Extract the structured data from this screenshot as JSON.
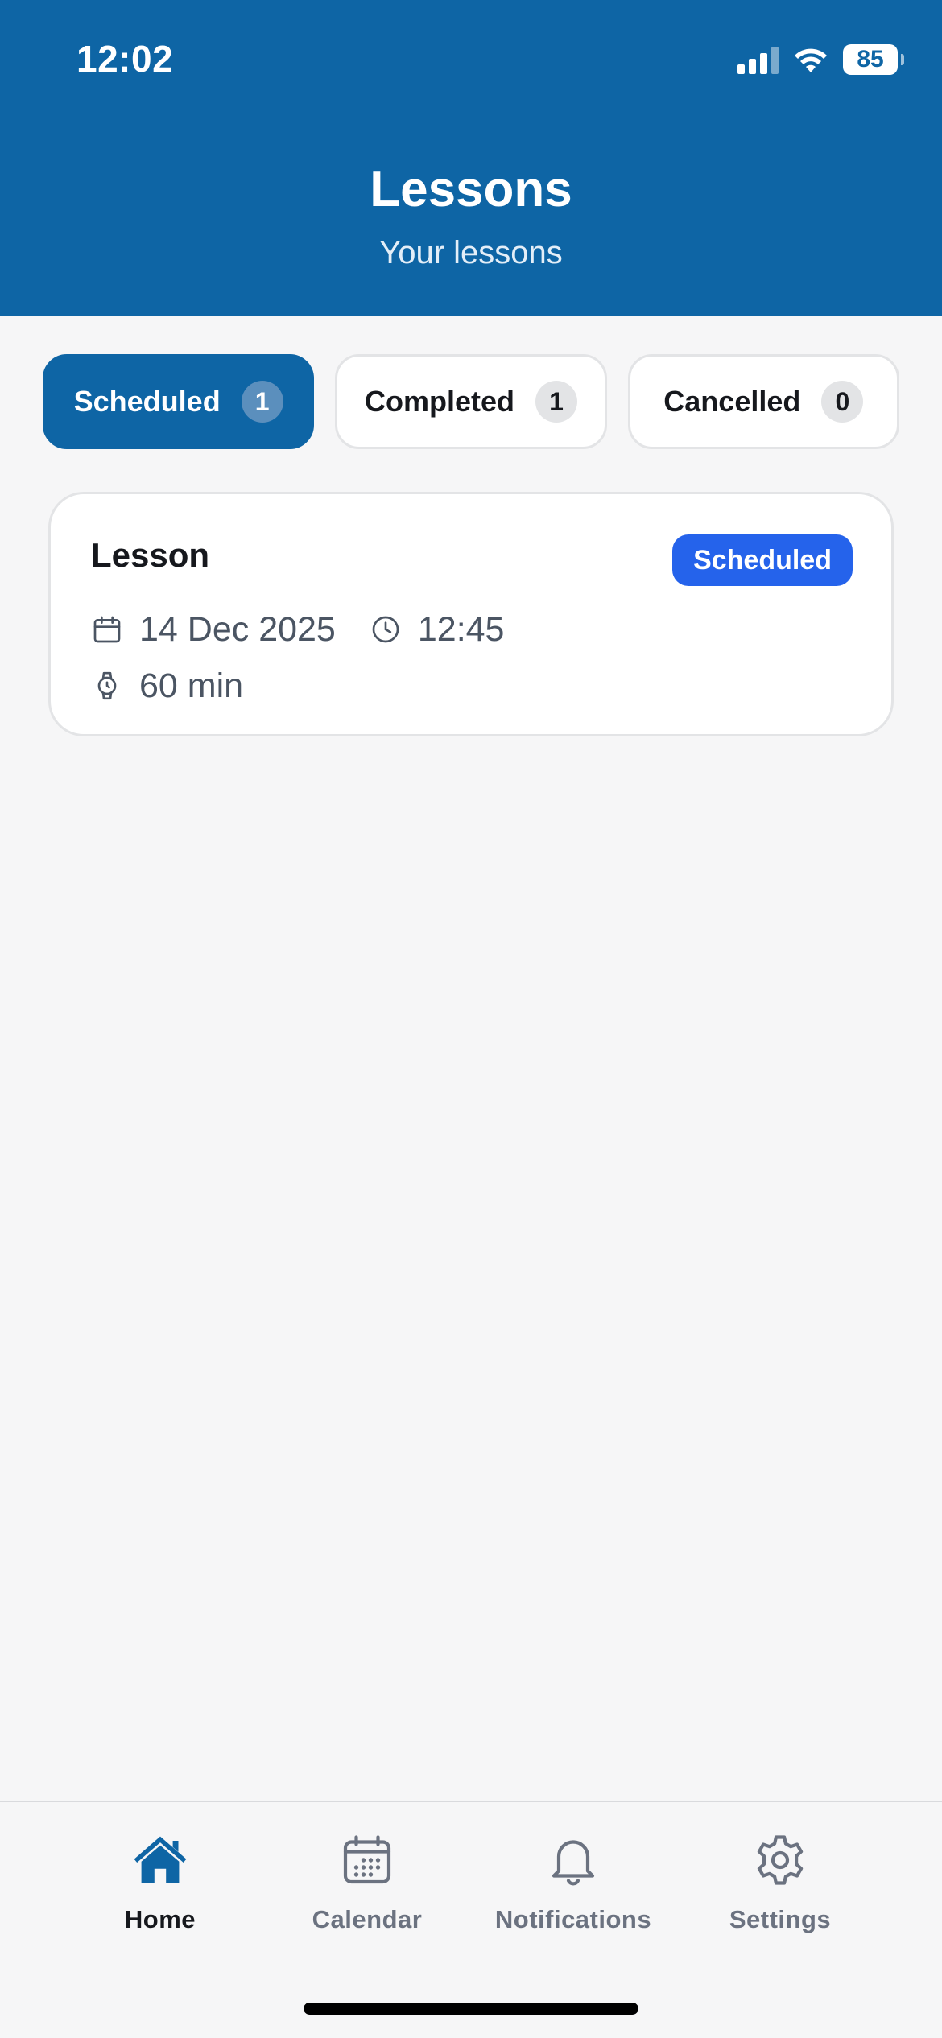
{
  "status_bar": {
    "time": "12:02",
    "battery_level": "85"
  },
  "header": {
    "title": "Lessons",
    "subtitle": "Your lessons"
  },
  "tabs": [
    {
      "label": "Scheduled",
      "count": "1",
      "active": true
    },
    {
      "label": "Completed",
      "count": "1",
      "active": false
    },
    {
      "label": "Cancelled",
      "count": "0",
      "active": false
    }
  ],
  "lessons": [
    {
      "title": "Lesson",
      "status": "Scheduled",
      "date": "14 Dec 2025",
      "time": "12:45",
      "duration": "60 min"
    }
  ],
  "bottom_nav": [
    {
      "label": "Home",
      "icon": "home-icon",
      "active": true
    },
    {
      "label": "Calendar",
      "icon": "calendar-icon",
      "active": false
    },
    {
      "label": "Notifications",
      "icon": "bell-icon",
      "active": false
    },
    {
      "label": "Settings",
      "icon": "gear-icon",
      "active": false
    }
  ],
  "colors": {
    "primary": "#0e65a5",
    "badge_blue": "#2563eb",
    "background": "#f6f6f7",
    "muted_text": "#6b7280"
  }
}
